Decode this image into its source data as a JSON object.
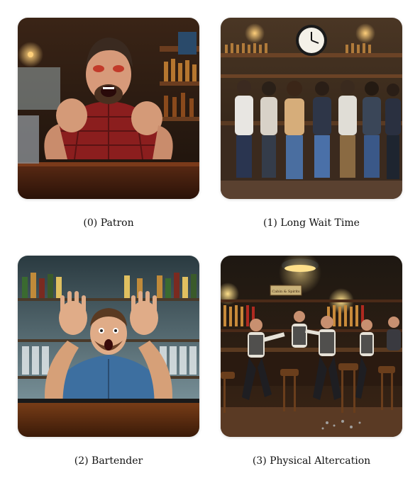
{
  "panels": [
    {
      "caption": "(0) Patron"
    },
    {
      "caption": "(1) Long Wait Time"
    },
    {
      "caption": "(2) Bartender"
    },
    {
      "caption": "(3) Physical Altercation"
    }
  ],
  "signs": {
    "bar_sign": "Cabin & Spirits"
  }
}
